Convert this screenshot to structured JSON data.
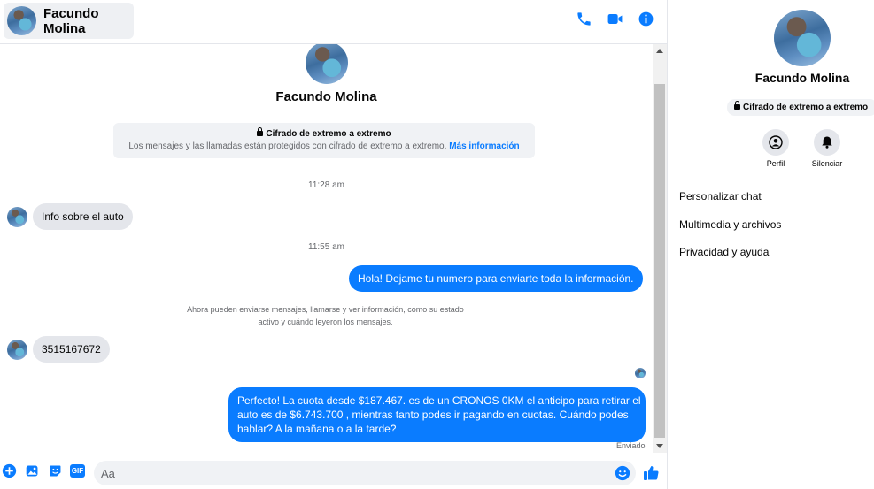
{
  "contact": {
    "name": "Facundo Molina"
  },
  "header": {
    "icons": [
      "phone-icon",
      "video-icon",
      "info-icon"
    ]
  },
  "e2e": {
    "title": "Cifrado de extremo a extremo",
    "description": "Los mensajes y las llamadas están protegidos con cifrado de extremo a extremo.",
    "link": "Más información"
  },
  "messages": [
    {
      "type": "timestamp",
      "text": "11:28 am"
    },
    {
      "type": "incoming",
      "text": "Info sobre el auto"
    },
    {
      "type": "timestamp",
      "text": "11:55 am"
    },
    {
      "type": "outgoing",
      "text": "Hola! Dejame tu numero  para enviarte toda la información."
    },
    {
      "type": "notice",
      "line1": "Ahora pueden enviarse mensajes, llamarse y ver información, como su estado",
      "line2": "activo y cuándo leyeron los mensajes."
    },
    {
      "type": "incoming",
      "text": "3515167672"
    },
    {
      "type": "outgoing",
      "line1": "Perfecto! La cuota desde $187.467. es de un CRONOS 0KM el anticipo para retirar el",
      "line2": "auto es de $6.743.700 , mientras tanto podes ir pagando en cuotas. Cuándo podes",
      "line3": "hablar? A la mañana o a la tarde?"
    }
  ],
  "status": {
    "sent": "Enviado"
  },
  "composer": {
    "placeholder": "Aa",
    "icons": [
      "plus-icon",
      "image-icon",
      "sticker-icon",
      "gif-icon",
      "emoji-icon",
      "like-icon"
    ],
    "gif_label": "GIF"
  },
  "sidebar": {
    "name": "Facundo Molina",
    "e2e_label": "Cifrado de extremo a extremo",
    "actions": [
      {
        "label": "Perfil",
        "icon": "profile-icon"
      },
      {
        "label": "Silenciar",
        "icon": "bell-icon"
      }
    ],
    "menu": [
      "Personalizar chat",
      "Multimedia y archivos",
      "Privacidad y ayuda"
    ]
  },
  "colors": {
    "accent": "#0a7cff",
    "incoming_bubble": "#e4e6eb",
    "panel_bg": "#f0f2f5"
  }
}
